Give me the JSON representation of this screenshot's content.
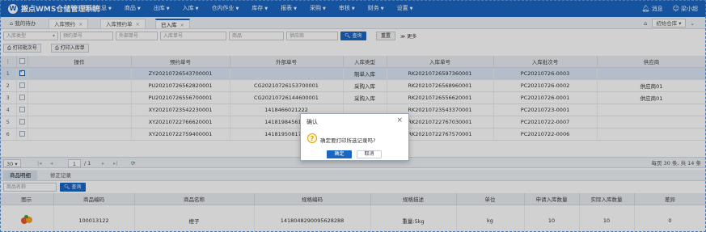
{
  "app": {
    "title": "搬点WMS仓储管理系统",
    "logo_glyph": "W"
  },
  "menu": [
    {
      "label": "基础信息"
    },
    {
      "label": "商品"
    },
    {
      "label": "出库"
    },
    {
      "label": "入库"
    },
    {
      "label": "仓内作业"
    },
    {
      "label": "库存"
    },
    {
      "label": "报表"
    },
    {
      "label": "采购"
    },
    {
      "label": "审核"
    },
    {
      "label": "财务"
    },
    {
      "label": "设置"
    }
  ],
  "top_right": {
    "message": "消息",
    "user": "梁小超"
  },
  "tabs": {
    "home": "我的待办",
    "items": [
      {
        "label": "入库预约"
      },
      {
        "label": "入库预约单"
      },
      {
        "label": "已入库"
      }
    ],
    "warehouse": "初始仓库"
  },
  "filter": {
    "type_placeholder": "入库类型",
    "reserve_placeholder": "预约单号",
    "external_placeholder": "外部单号",
    "inbound_placeholder": "入库单号",
    "goods_placeholder": "商品",
    "supplier_placeholder": "供应商",
    "search_label": "查询",
    "reset_label": "重置",
    "more_label": "更多"
  },
  "actions": {
    "print_batch": "打印批次号",
    "print_inbound": "打印入库单"
  },
  "grid": {
    "columns": [
      "操作",
      "预约单号",
      "外部单号",
      "入库类型",
      "入库单号",
      "入库批次号",
      "供应商"
    ],
    "rows": [
      {
        "n": "1",
        "checked": true,
        "reserve": "ZY20210726543700001",
        "external": "",
        "type": "制单入库",
        "inbound": "RK20210726597360001",
        "batch": "PC20210726-0003",
        "supplier": ""
      },
      {
        "n": "2",
        "checked": false,
        "reserve": "PU20210726562820001",
        "external": "CG20210726153700001",
        "type": "采购入库",
        "inbound": "RK20210726568960001",
        "batch": "PC20210726-0002",
        "supplier": "供应商01"
      },
      {
        "n": "3",
        "checked": false,
        "reserve": "PU20210726556700001",
        "external": "CG20210726144600001",
        "type": "采购入库",
        "inbound": "RK20210726556620001",
        "batch": "PC20210726-0001",
        "supplier": "供应商01"
      },
      {
        "n": "4",
        "checked": false,
        "reserve": "XY20210723542230001",
        "external": "1418466021222",
        "type": "",
        "inbound": "RK20210723543370001",
        "batch": "PC20210723-0001",
        "supplier": ""
      },
      {
        "n": "5",
        "checked": false,
        "reserve": "XY20210722766620001",
        "external": "1418198456124",
        "type": "",
        "inbound": "RK20210722767030001",
        "batch": "PC20210722-0007",
        "supplier": ""
      },
      {
        "n": "6",
        "checked": false,
        "reserve": "XY20210722759400001",
        "external": "1418195081782",
        "type": "",
        "inbound": "RK20210722767570001",
        "batch": "PC20210722-0006",
        "supplier": ""
      }
    ]
  },
  "pager": {
    "page_size": "30",
    "page": "1",
    "total_pages": "/ 1",
    "summary": "每页 30 条, 共 14 条"
  },
  "bottom_tabs": [
    {
      "label": "商品明细"
    },
    {
      "label": "修正记录"
    }
  ],
  "detail_filter": {
    "goods_placeholder": "商品名称",
    "search_label": "查询"
  },
  "detail": {
    "columns": [
      "图示",
      "商品编码",
      "商品名称",
      "规格编码",
      "规格描述",
      "单位",
      "申请入库数量",
      "实际入库数量",
      "差异"
    ],
    "rows": [
      {
        "code": "100013122",
        "name": "橙子",
        "spec_code": "1418048290095628288",
        "spec_desc": "重量:5kg",
        "unit": "kg",
        "apply": "10",
        "actual": "10",
        "diff": "0"
      }
    ]
  },
  "dialog": {
    "title": "确认",
    "message": "确定要打印所选记录吗?",
    "ok_label": "确定",
    "cancel_label": "取消",
    "icon_glyph": "?"
  }
}
